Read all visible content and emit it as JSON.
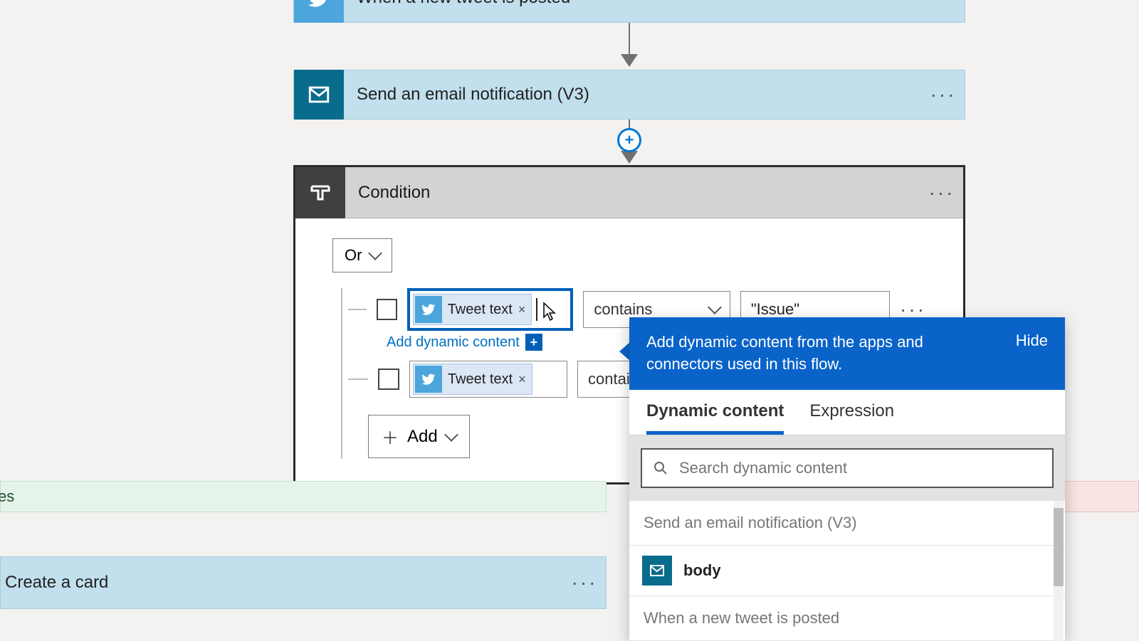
{
  "trigger": {
    "label": "When a new tweet is posted"
  },
  "email_step": {
    "label": "Send an email notification (V3)"
  },
  "condition": {
    "title": "Condition",
    "group_operator": "Or",
    "add_dynamic_content": "Add dynamic content",
    "add_button": "Add",
    "rows": [
      {
        "token_label": "Tweet text",
        "operator": "contains",
        "value": "\"Issue\""
      },
      {
        "token_label": "Tweet text",
        "operator": "contains",
        "value": ""
      }
    ]
  },
  "bottom_card": {
    "label": "Create a card"
  },
  "yes_label": "es",
  "dc_panel": {
    "message": "Add dynamic content from the apps and connectors used in this flow.",
    "hide": "Hide",
    "tabs": {
      "dynamic": "Dynamic content",
      "expression": "Expression"
    },
    "search_placeholder": "Search dynamic content",
    "groups": [
      {
        "name": "Send an email notification (V3)",
        "items": [
          {
            "label": "body",
            "icon": "mail"
          }
        ]
      },
      {
        "name": "When a new tweet is posted",
        "items": []
      }
    ]
  },
  "icons": {
    "twitter": "twitter-bird",
    "mail": "envelope",
    "condition": "branch",
    "search": "magnifier",
    "plus": "+",
    "chevron_down": "chevron-down"
  }
}
